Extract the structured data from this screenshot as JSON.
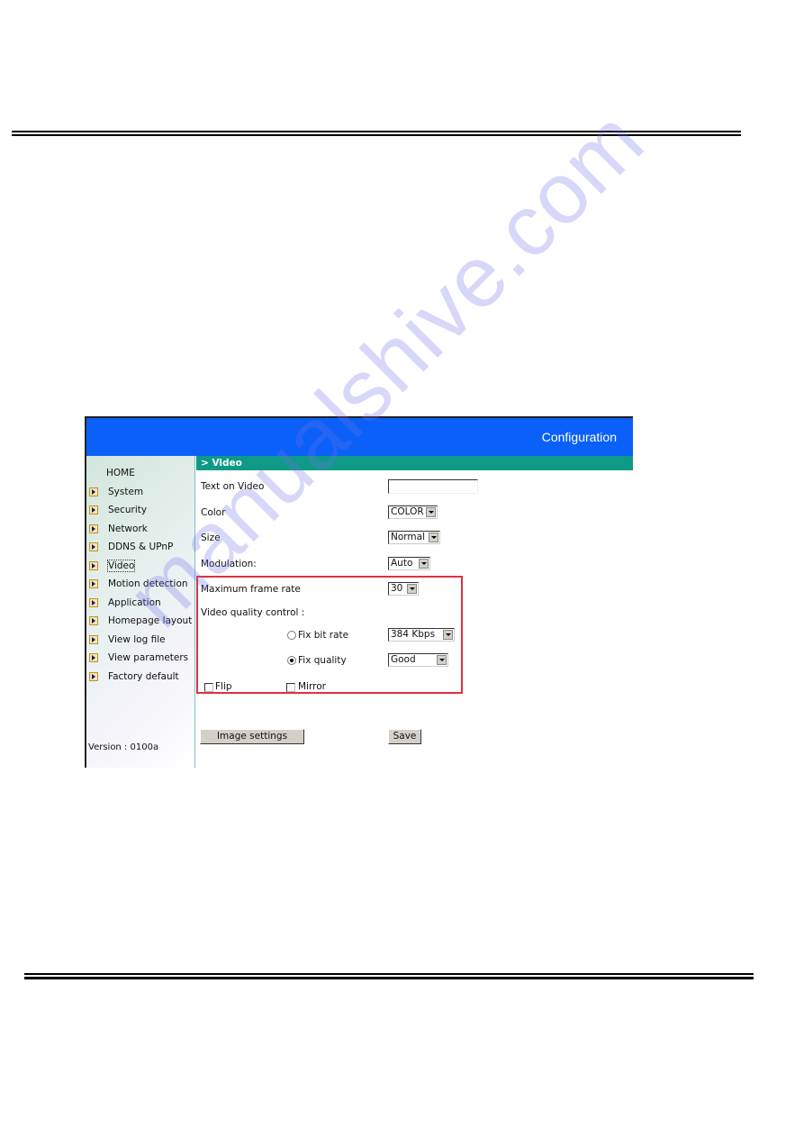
{
  "watermark": "manualshive.com",
  "screenshot": {
    "banner_title": "Configuration",
    "section_title": "> Video",
    "sidebar": {
      "items": [
        {
          "label": "HOME",
          "bullet": false,
          "active": false
        },
        {
          "label": "System",
          "bullet": true,
          "active": false
        },
        {
          "label": "Security",
          "bullet": true,
          "active": false
        },
        {
          "label": "Network",
          "bullet": true,
          "active": false
        },
        {
          "label": "DDNS & UPnP",
          "bullet": true,
          "active": false
        },
        {
          "label": "Video",
          "bullet": true,
          "active": true
        },
        {
          "label": "Motion detection",
          "bullet": true,
          "active": false
        },
        {
          "label": "Application",
          "bullet": true,
          "active": false
        },
        {
          "label": "Homepage layout",
          "bullet": true,
          "active": false
        },
        {
          "label": "View log file",
          "bullet": true,
          "active": false
        },
        {
          "label": "View parameters",
          "bullet": true,
          "active": false
        },
        {
          "label": "Factory default",
          "bullet": true,
          "active": false
        }
      ],
      "version": "Version : 0100a"
    },
    "form": {
      "text_on_video": {
        "label": "Text on Video",
        "value": ""
      },
      "color": {
        "label": "Color",
        "value": "COLOR"
      },
      "size": {
        "label": "Size",
        "value": "Normal"
      },
      "modulation": {
        "label": "Modulation:",
        "value": "Auto"
      },
      "max_frame_rate": {
        "label": "Maximum frame rate",
        "value": "30"
      },
      "video_quality_control": {
        "label": "Video quality control :"
      },
      "fix_bit_rate": {
        "label": "Fix bit rate",
        "checked": false,
        "value": "384 Kbps"
      },
      "fix_quality": {
        "label": "Fix quality",
        "checked": true,
        "value": "Good"
      },
      "flip": {
        "label": "Flip",
        "checked": false
      },
      "mirror": {
        "label": "Mirror",
        "checked": false
      }
    },
    "buttons": {
      "image_settings": "Image settings",
      "save": "Save"
    },
    "colors": {
      "banner": "#0a60f8",
      "section_bar": "#0e9a86",
      "highlight_box": "#e03040"
    }
  }
}
